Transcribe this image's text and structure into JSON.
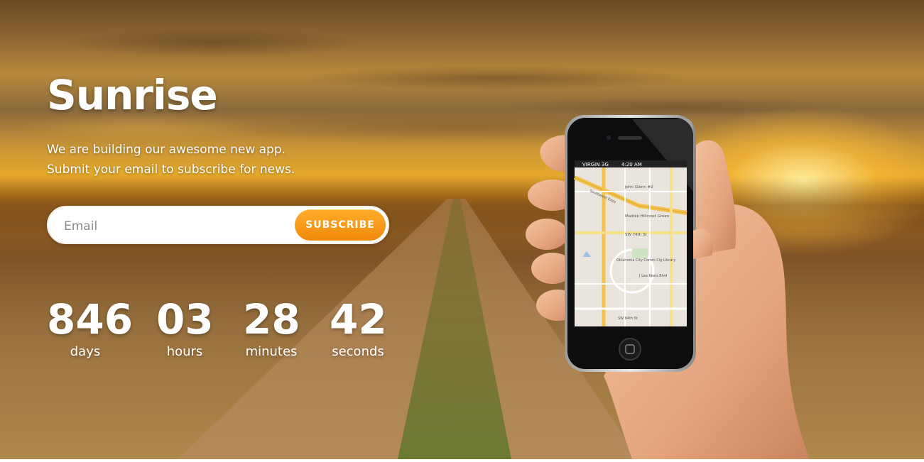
{
  "hero": {
    "title": "Sunrise",
    "subtitle_line1": "We are building our awesome new app.",
    "subtitle_line2": "Submit your email to subscribe for news."
  },
  "form": {
    "email_placeholder": "Email",
    "email_value": "",
    "subscribe_label": "SUBSCRIBE"
  },
  "countdown": [
    {
      "value": "846",
      "label": "days"
    },
    {
      "value": "03",
      "label": "hours"
    },
    {
      "value": "28",
      "label": "minutes"
    },
    {
      "value": "42",
      "label": "seconds"
    }
  ],
  "phone": {
    "carrier": "VIRGIN",
    "network": "3G",
    "time": "4:20 AM",
    "map_labels": [
      "Southwest Expy",
      "SW 74th St",
      "SW 84th St",
      "Madole Hillcrest Green",
      "John Glenn #2",
      "Oklahoma City Comm Clg Library",
      "J Lee Keels Blvd"
    ]
  },
  "colors": {
    "accent": "#f39418",
    "text": "#ffffff"
  }
}
